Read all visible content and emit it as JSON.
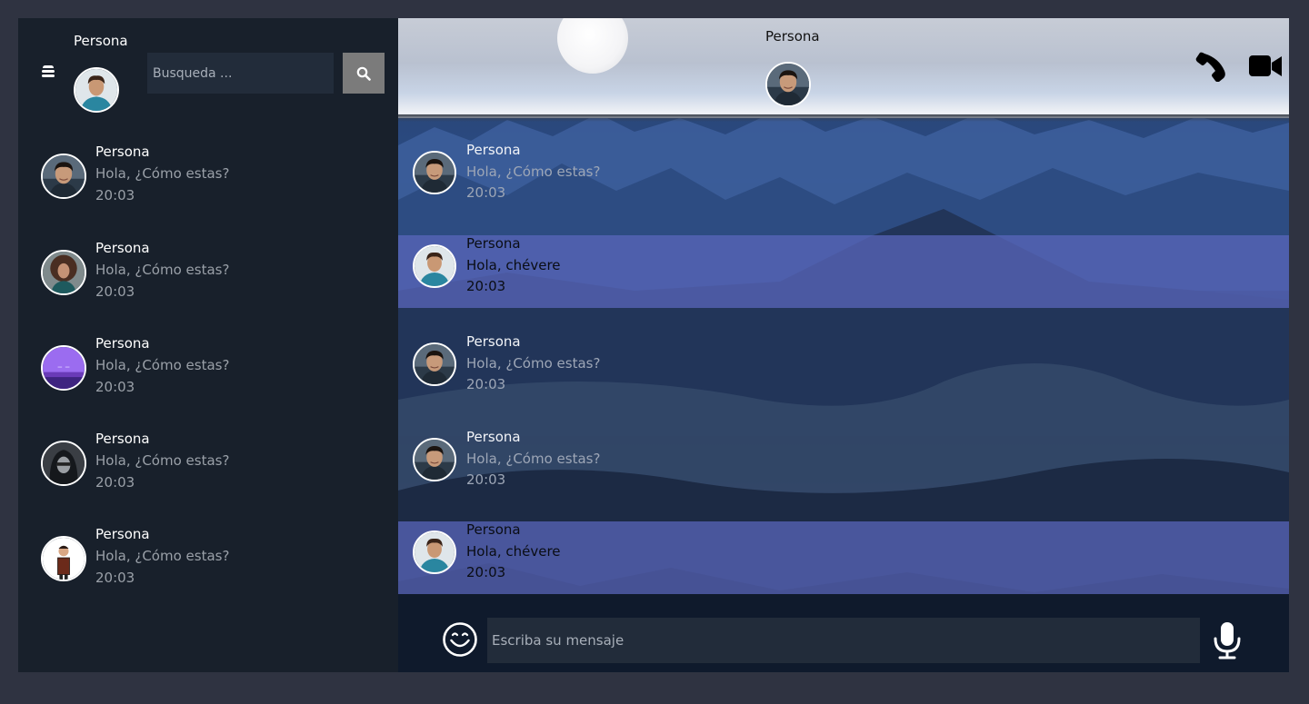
{
  "sidebar": {
    "menu_icon": "hamburger-menu-icon",
    "profile_name": "Persona",
    "search": {
      "placeholder": "Busqueda ...",
      "value": "",
      "icon": "search-icon"
    },
    "contacts": [
      {
        "name": "Persona",
        "message": "Hola, ¿Cómo estas?",
        "time": "20:03",
        "avatar": "man-portrait"
      },
      {
        "name": "Persona",
        "message": "Hola, ¿Cómo estas?",
        "time": "20:03",
        "avatar": "curly-hair-portrait"
      },
      {
        "name": "Persona",
        "message": "Hola, ¿Cómo estas?",
        "time": "20:03",
        "avatar": "purple-landscape"
      },
      {
        "name": "Persona",
        "message": "Hola, ¿Cómo estas?",
        "time": "20:03",
        "avatar": "hooded-figure"
      },
      {
        "name": "Persona",
        "message": "Hola, ¿Cómo estas?",
        "time": "20:03",
        "avatar": "cartoon-man"
      }
    ]
  },
  "chat": {
    "header": {
      "name": "Persona",
      "call_icon": "phone-icon",
      "video_icon": "video-camera-icon"
    },
    "messages": [
      {
        "name": "Persona",
        "text": "Hola, ¿Cómo estas?",
        "time": "20:03",
        "direction": "in"
      },
      {
        "name": "Persona",
        "text": "Hola, chévere",
        "time": "20:03",
        "direction": "out"
      },
      {
        "name": "Persona",
        "text": "Hola, ¿Cómo estas?",
        "time": "20:03",
        "direction": "in"
      },
      {
        "name": "Persona",
        "text": "Hola, ¿Cómo estas?",
        "time": "20:03",
        "direction": "in"
      },
      {
        "name": "Persona",
        "text": "Hola, chévere",
        "time": "20:03",
        "direction": "out"
      }
    ],
    "composer": {
      "placeholder": "Escriba su mensaje",
      "value": "",
      "emoji_icon": "smiley-icon",
      "mic_icon": "microphone-icon"
    }
  },
  "colors": {
    "page_background": "#2f3341",
    "sidebar_background": "#18202b",
    "input_background": "#222c3a",
    "search_button": "#7b7b7b",
    "outgoing_bubble": "#5c68be",
    "muted_text": "#9aa0a8"
  }
}
